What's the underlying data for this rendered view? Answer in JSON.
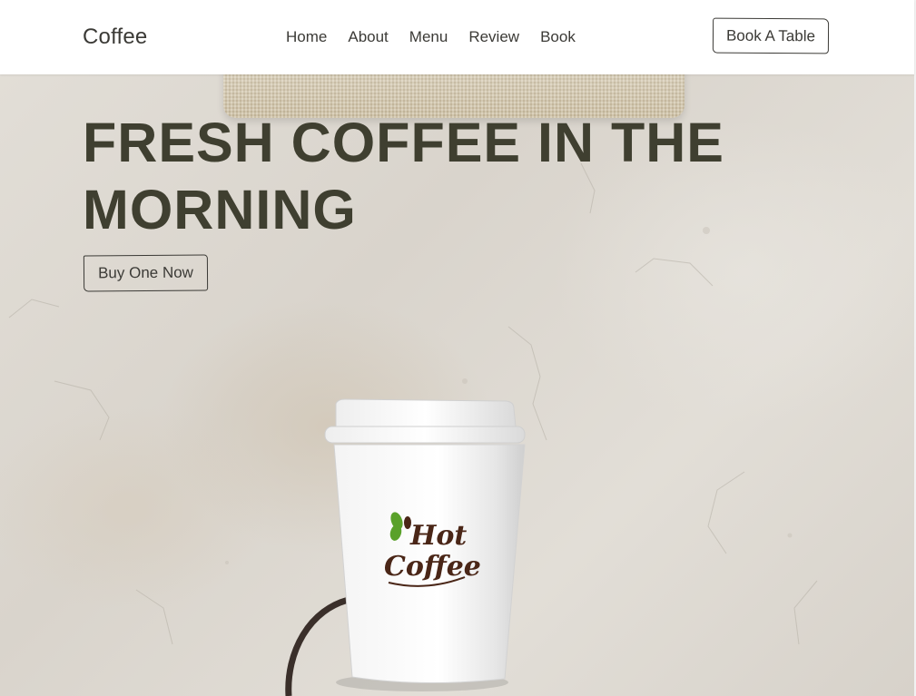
{
  "header": {
    "logo": "Coffee",
    "nav": [
      "Home",
      "About",
      "Menu",
      "Review",
      "Book"
    ],
    "cta_label": "Book A Table"
  },
  "hero": {
    "title_line1": "FRESH COFFEE IN THE",
    "title_line2": "MORNING",
    "button_label": "Buy One Now"
  },
  "cup": {
    "logo_line1": "Hot",
    "logo_line2": "Coffee"
  },
  "colors": {
    "text_dark": "#3b3a36",
    "title": "#3f3f30",
    "logo_brown": "#4a2617",
    "bean_green": "#5aa12a"
  }
}
